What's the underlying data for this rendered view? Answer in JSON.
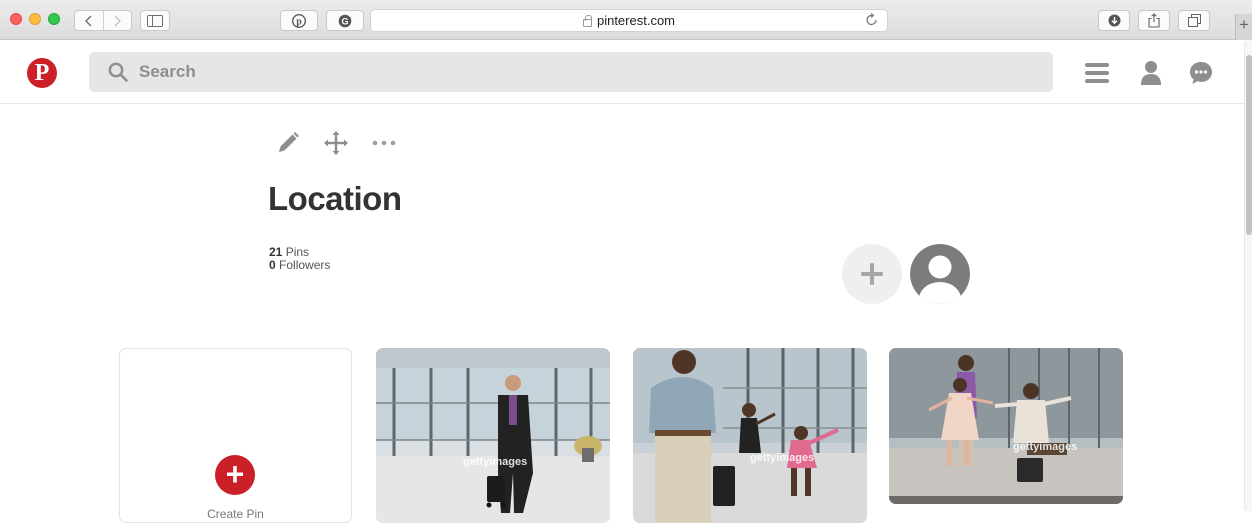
{
  "browser": {
    "address": "pinterest.com",
    "back_icon": "chevron-left-icon",
    "forward_icon": "chevron-right-icon",
    "reload_icon": "reload-icon"
  },
  "header": {
    "logo": "P",
    "search_placeholder": "Search",
    "icons": [
      "menu-icon",
      "person-icon",
      "chat-bubble-icon"
    ]
  },
  "board": {
    "title": "Location",
    "pins_count": "21",
    "pins_label": "Pins",
    "followers_count": "0",
    "followers_label": "Followers"
  },
  "grid": {
    "create_label": "Create Pin",
    "pins": [
      {
        "watermark": "gettyimages"
      },
      {
        "watermark": "gettyimages"
      },
      {
        "watermark": "gettyimages"
      }
    ]
  },
  "colors": {
    "brand": "#cb2027",
    "search_bg": "#e6e6e6"
  }
}
